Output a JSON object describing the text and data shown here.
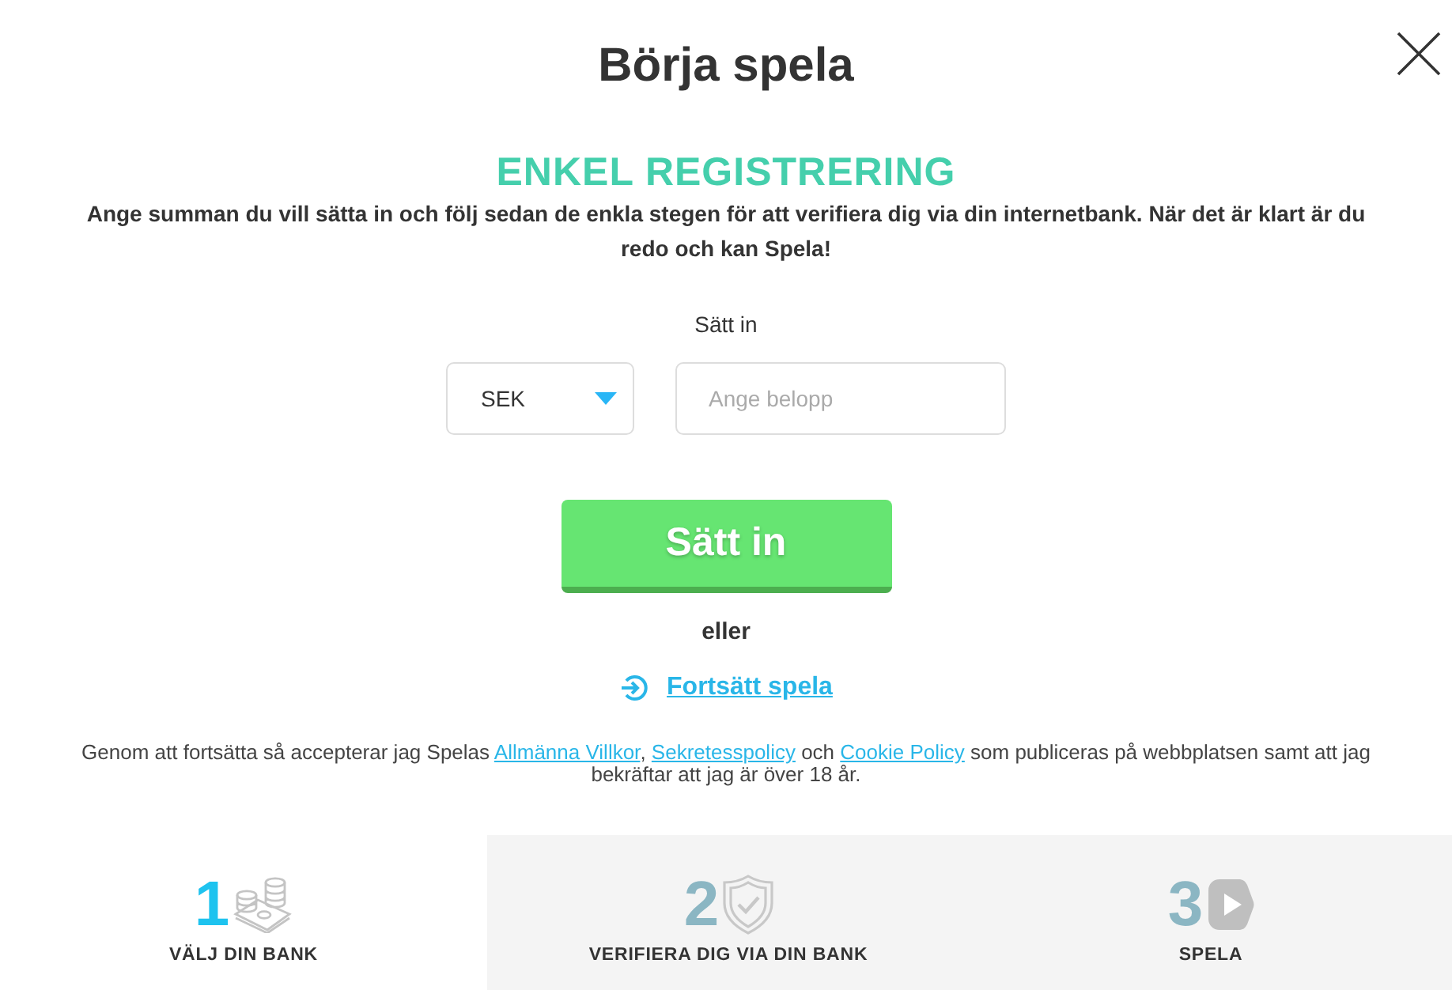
{
  "dialog": {
    "title": "Börja spela"
  },
  "heading": "ENKEL REGISTRERING",
  "intro": "Ange summan du vill sätta in och följ sedan de enkla stegen för att verifiera dig via din internetbank. När det är klart är du redo och kan Spela!",
  "deposit": {
    "label": "Sätt in",
    "currency": "SEK",
    "amount": {
      "placeholder": "Ange belopp"
    },
    "submit": "Sätt in"
  },
  "separator": "eller",
  "continue_link": "Fortsätt spela",
  "terms": [
    {
      "kind": "text",
      "text": "Genom att fortsätta så accepterar jag Spelas "
    },
    {
      "kind": "link",
      "text": "Allmänna Villkor"
    },
    {
      "kind": "text",
      "text": ", "
    },
    {
      "kind": "link",
      "text": "Sekretesspolicy"
    },
    {
      "kind": "text",
      "text": " och "
    },
    {
      "kind": "link",
      "text": "Cookie Policy"
    },
    {
      "kind": "text",
      "text": " som publiceras på webbplatsen samt att jag bekräftar att jag är över 18 år."
    }
  ],
  "steps": [
    {
      "number": "1",
      "label": "VÄLJ DIN BANK",
      "selected": true
    },
    {
      "number": "2",
      "label": "VERIFIERA DIG VIA DIN BANK",
      "selected": false
    },
    {
      "number": "3",
      "label": "SPELA",
      "selected": false
    }
  ]
}
